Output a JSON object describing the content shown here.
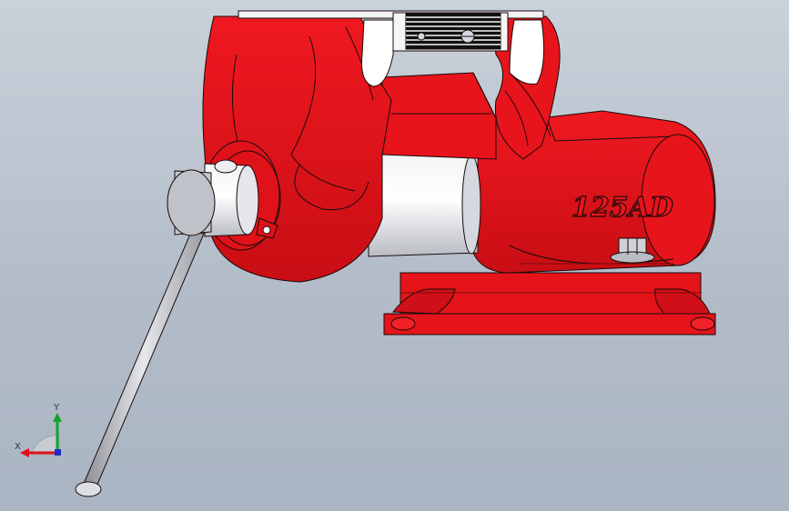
{
  "viewport": {
    "background_top": "#c9d1da",
    "background_bottom": "#aab5c3"
  },
  "model": {
    "part_color": "#e8141c",
    "steel_color": "#d9dce0",
    "edge_color": "#1a0a0a",
    "body_marking": "125AD"
  },
  "triad": {
    "x_label": "X",
    "y_label": "Y",
    "x_color": "#e0101a",
    "y_color": "#12a52a",
    "z_color": "#1a2cc8"
  }
}
